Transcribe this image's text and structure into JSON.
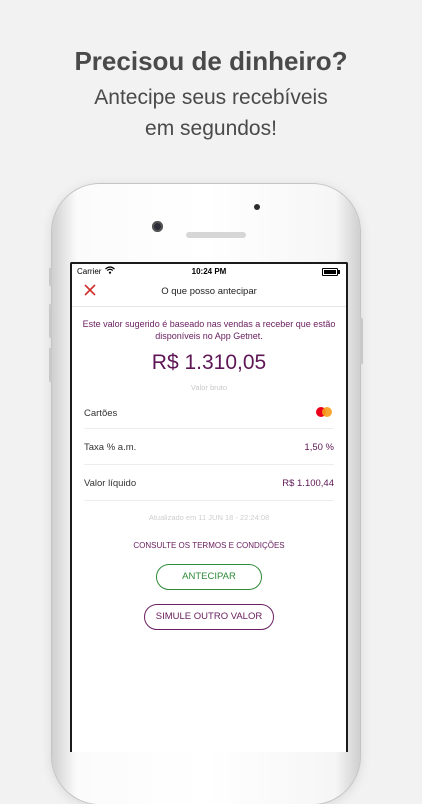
{
  "promo": {
    "headline": "Precisou de dinheiro?",
    "subline_1": "Antecipe seus recebíveis",
    "subline_2": "em segundos!"
  },
  "status_bar": {
    "carrier": "Carrier",
    "time": "10:24 PM"
  },
  "nav": {
    "title": "O que posso antecipar"
  },
  "content": {
    "info_text": "Este valor sugerido é baseado nas vendas a receber que estão disponíveis no App Getnet.",
    "amount": "R$ 1.310,05",
    "amount_caption": "Valor bruto",
    "rows": [
      {
        "label": "Cartões",
        "value": ""
      },
      {
        "label": "Taxa % a.m.",
        "value": "1,50 %"
      },
      {
        "label": "Valor líquido",
        "value": "R$ 1.100,44"
      }
    ],
    "updated": "Atualizado em 11 JUN 18 - 22:24:08",
    "terms_link": "CONSULTE OS TERMOS E CONDIÇÕES",
    "primary_button": "ANTECIPAR",
    "secondary_button": "SIMULE OUTRO VALOR"
  },
  "colors": {
    "brand_purple": "#5e1656",
    "accent_green": "#2e8b38",
    "close_red": "#d0312d"
  },
  "icons": {
    "close": "close-icon",
    "card_brand": "mastercard-icon",
    "wifi": "wifi-icon",
    "battery": "battery-icon"
  }
}
